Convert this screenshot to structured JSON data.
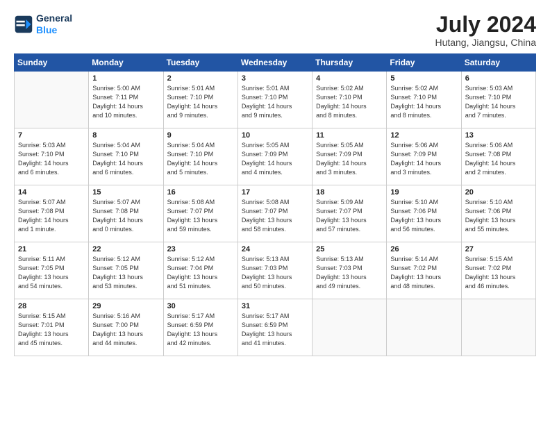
{
  "header": {
    "logo_line1": "General",
    "logo_line2": "Blue",
    "month_year": "July 2024",
    "location": "Hutang, Jiangsu, China"
  },
  "weekdays": [
    "Sunday",
    "Monday",
    "Tuesday",
    "Wednesday",
    "Thursday",
    "Friday",
    "Saturday"
  ],
  "weeks": [
    [
      {
        "day": "",
        "info": ""
      },
      {
        "day": "1",
        "info": "Sunrise: 5:00 AM\nSunset: 7:11 PM\nDaylight: 14 hours\nand 10 minutes."
      },
      {
        "day": "2",
        "info": "Sunrise: 5:01 AM\nSunset: 7:10 PM\nDaylight: 14 hours\nand 9 minutes."
      },
      {
        "day": "3",
        "info": "Sunrise: 5:01 AM\nSunset: 7:10 PM\nDaylight: 14 hours\nand 9 minutes."
      },
      {
        "day": "4",
        "info": "Sunrise: 5:02 AM\nSunset: 7:10 PM\nDaylight: 14 hours\nand 8 minutes."
      },
      {
        "day": "5",
        "info": "Sunrise: 5:02 AM\nSunset: 7:10 PM\nDaylight: 14 hours\nand 8 minutes."
      },
      {
        "day": "6",
        "info": "Sunrise: 5:03 AM\nSunset: 7:10 PM\nDaylight: 14 hours\nand 7 minutes."
      }
    ],
    [
      {
        "day": "7",
        "info": "Sunrise: 5:03 AM\nSunset: 7:10 PM\nDaylight: 14 hours\nand 6 minutes."
      },
      {
        "day": "8",
        "info": "Sunrise: 5:04 AM\nSunset: 7:10 PM\nDaylight: 14 hours\nand 6 minutes."
      },
      {
        "day": "9",
        "info": "Sunrise: 5:04 AM\nSunset: 7:10 PM\nDaylight: 14 hours\nand 5 minutes."
      },
      {
        "day": "10",
        "info": "Sunrise: 5:05 AM\nSunset: 7:09 PM\nDaylight: 14 hours\nand 4 minutes."
      },
      {
        "day": "11",
        "info": "Sunrise: 5:05 AM\nSunset: 7:09 PM\nDaylight: 14 hours\nand 3 minutes."
      },
      {
        "day": "12",
        "info": "Sunrise: 5:06 AM\nSunset: 7:09 PM\nDaylight: 14 hours\nand 3 minutes."
      },
      {
        "day": "13",
        "info": "Sunrise: 5:06 AM\nSunset: 7:08 PM\nDaylight: 14 hours\nand 2 minutes."
      }
    ],
    [
      {
        "day": "14",
        "info": "Sunrise: 5:07 AM\nSunset: 7:08 PM\nDaylight: 14 hours\nand 1 minute."
      },
      {
        "day": "15",
        "info": "Sunrise: 5:07 AM\nSunset: 7:08 PM\nDaylight: 14 hours\nand 0 minutes."
      },
      {
        "day": "16",
        "info": "Sunrise: 5:08 AM\nSunset: 7:07 PM\nDaylight: 13 hours\nand 59 minutes."
      },
      {
        "day": "17",
        "info": "Sunrise: 5:08 AM\nSunset: 7:07 PM\nDaylight: 13 hours\nand 58 minutes."
      },
      {
        "day": "18",
        "info": "Sunrise: 5:09 AM\nSunset: 7:07 PM\nDaylight: 13 hours\nand 57 minutes."
      },
      {
        "day": "19",
        "info": "Sunrise: 5:10 AM\nSunset: 7:06 PM\nDaylight: 13 hours\nand 56 minutes."
      },
      {
        "day": "20",
        "info": "Sunrise: 5:10 AM\nSunset: 7:06 PM\nDaylight: 13 hours\nand 55 minutes."
      }
    ],
    [
      {
        "day": "21",
        "info": "Sunrise: 5:11 AM\nSunset: 7:05 PM\nDaylight: 13 hours\nand 54 minutes."
      },
      {
        "day": "22",
        "info": "Sunrise: 5:12 AM\nSunset: 7:05 PM\nDaylight: 13 hours\nand 53 minutes."
      },
      {
        "day": "23",
        "info": "Sunrise: 5:12 AM\nSunset: 7:04 PM\nDaylight: 13 hours\nand 51 minutes."
      },
      {
        "day": "24",
        "info": "Sunrise: 5:13 AM\nSunset: 7:03 PM\nDaylight: 13 hours\nand 50 minutes."
      },
      {
        "day": "25",
        "info": "Sunrise: 5:13 AM\nSunset: 7:03 PM\nDaylight: 13 hours\nand 49 minutes."
      },
      {
        "day": "26",
        "info": "Sunrise: 5:14 AM\nSunset: 7:02 PM\nDaylight: 13 hours\nand 48 minutes."
      },
      {
        "day": "27",
        "info": "Sunrise: 5:15 AM\nSunset: 7:02 PM\nDaylight: 13 hours\nand 46 minutes."
      }
    ],
    [
      {
        "day": "28",
        "info": "Sunrise: 5:15 AM\nSunset: 7:01 PM\nDaylight: 13 hours\nand 45 minutes."
      },
      {
        "day": "29",
        "info": "Sunrise: 5:16 AM\nSunset: 7:00 PM\nDaylight: 13 hours\nand 44 minutes."
      },
      {
        "day": "30",
        "info": "Sunrise: 5:17 AM\nSunset: 6:59 PM\nDaylight: 13 hours\nand 42 minutes."
      },
      {
        "day": "31",
        "info": "Sunrise: 5:17 AM\nSunset: 6:59 PM\nDaylight: 13 hours\nand 41 minutes."
      },
      {
        "day": "",
        "info": ""
      },
      {
        "day": "",
        "info": ""
      },
      {
        "day": "",
        "info": ""
      }
    ]
  ]
}
